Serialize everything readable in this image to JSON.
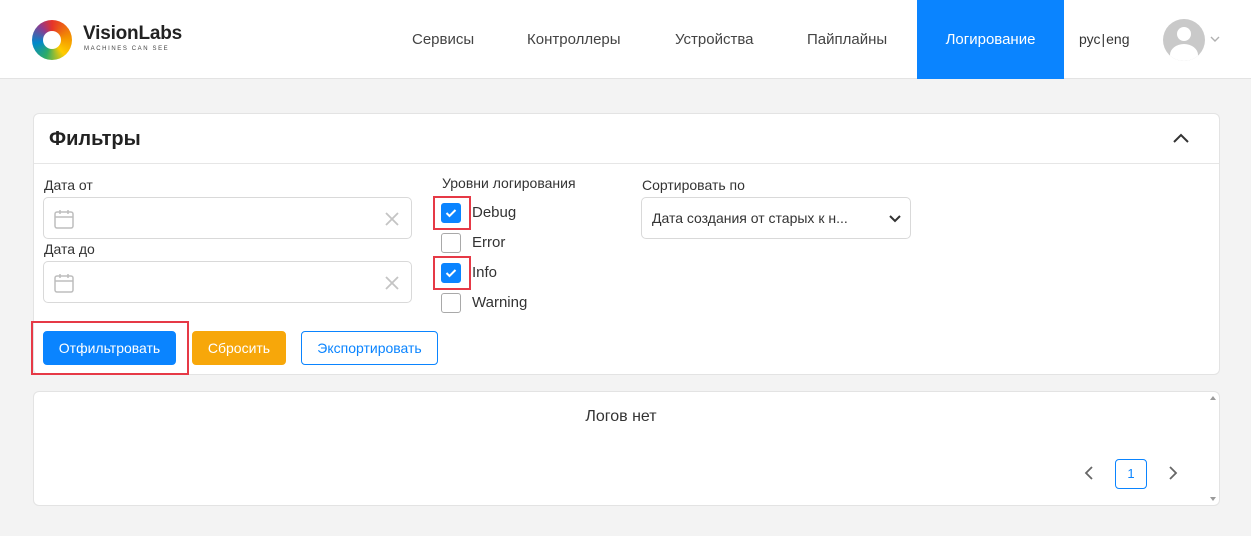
{
  "brand": {
    "name": "VisionLabs",
    "tagline": "MACHINES CAN SEE"
  },
  "nav": {
    "items": [
      {
        "label": "Сервисы"
      },
      {
        "label": "Контроллеры"
      },
      {
        "label": "Устройства"
      },
      {
        "label": "Пайплайны"
      },
      {
        "label": "Логирование",
        "active": true
      }
    ],
    "lang": {
      "ru": "рус",
      "en": "eng",
      "separator": "|"
    },
    "user_icon": "user-avatar-icon"
  },
  "filters": {
    "title": "Фильтры",
    "date_from": {
      "label": "Дата от",
      "value": ""
    },
    "date_to": {
      "label": "Дата до",
      "value": ""
    },
    "levels": {
      "label": "Уровни логирования",
      "options": [
        {
          "label": "Debug",
          "checked": true
        },
        {
          "label": "Error",
          "checked": false
        },
        {
          "label": "Info",
          "checked": true
        },
        {
          "label": "Warning",
          "checked": false
        }
      ]
    },
    "sort": {
      "label": "Сортировать по",
      "value": "Дата создания от старых к н..."
    },
    "buttons": {
      "filter": "Отфильтровать",
      "reset": "Сбросить",
      "export": "Экспортировать"
    }
  },
  "logs": {
    "empty_text": "Логов нет",
    "pagination": {
      "current_page": "1"
    }
  },
  "colors": {
    "accent": "#0a84ff",
    "warning": "#f7a70a",
    "highlight": "#e63946"
  }
}
